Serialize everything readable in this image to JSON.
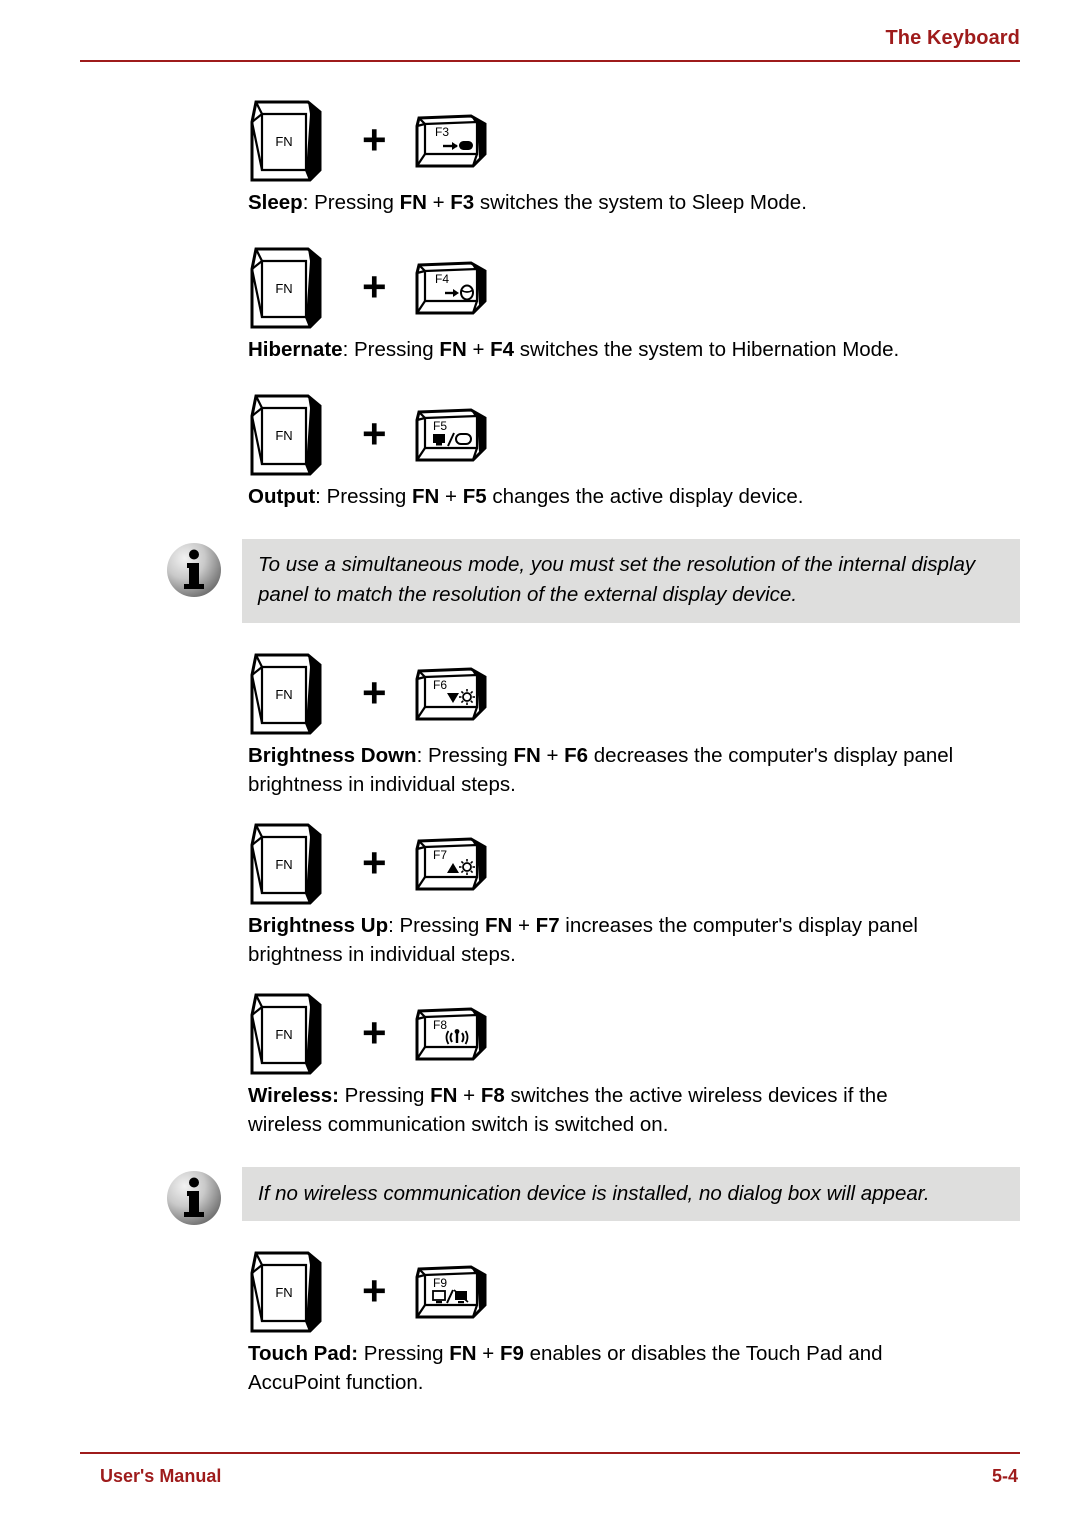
{
  "header": {
    "title": "The Keyboard"
  },
  "footer": {
    "left": "User's Manual",
    "page": "5-4"
  },
  "sections": [
    {
      "key_combo": {
        "modifier": "FN",
        "function_key": "F3",
        "separator": "+",
        "icon": "sleep-arrow-icon"
      },
      "paragraph": {
        "term": "Sleep",
        "after_term": ": Pressing ",
        "bold1": "FN",
        "mid": " + ",
        "bold2": "F3",
        "tail": " switches the system to Sleep Mode."
      }
    },
    {
      "key_combo": {
        "modifier": "FN",
        "function_key": "F4",
        "separator": "+",
        "icon": "hibernate-disk-icon"
      },
      "paragraph": {
        "term": "Hibernate",
        "after_term": ": Pressing ",
        "bold1": "FN",
        "mid": " + ",
        "bold2": "F4",
        "tail": " switches the system to Hibernation Mode."
      }
    },
    {
      "key_combo": {
        "modifier": "FN",
        "function_key": "F5",
        "separator": "+",
        "icon": "display-output-icon"
      },
      "paragraph": {
        "term": "Output",
        "after_term": ": Pressing ",
        "bold1": "FN",
        "mid": " + ",
        "bold2": "F5",
        "tail": " changes the active display device."
      }
    },
    {
      "key_combo": {
        "modifier": "FN",
        "function_key": "F6",
        "separator": "+",
        "icon": "brightness-down-icon"
      },
      "paragraph": {
        "term": "Brightness Down",
        "after_term": ": Pressing ",
        "bold1": "FN",
        "mid": " + ",
        "bold2": "F6",
        "tail": " decreases the computer's display panel brightness in individual steps."
      }
    },
    {
      "key_combo": {
        "modifier": "FN",
        "function_key": "F7",
        "separator": "+",
        "icon": "brightness-up-icon"
      },
      "paragraph": {
        "term": "Brightness Up",
        "after_term": ": Pressing ",
        "bold1": "FN",
        "mid": " + ",
        "bold2": "F7",
        "tail": " increases the computer's display panel brightness in individual steps."
      }
    },
    {
      "key_combo": {
        "modifier": "FN",
        "function_key": "F8",
        "separator": "+",
        "icon": "wireless-antenna-icon"
      },
      "paragraph": {
        "term": "Wireless:",
        "after_term": " Pressing ",
        "bold1": "FN",
        "mid": " + ",
        "bold2": "F8",
        "tail": " switches the active wireless devices if the wireless communication switch is switched on."
      }
    },
    {
      "key_combo": {
        "modifier": "FN",
        "function_key": "F9",
        "separator": "+",
        "icon": "touchpad-toggle-icon"
      },
      "paragraph": {
        "term": "Touch Pad:",
        "after_term": " Pressing ",
        "bold1": "FN",
        "mid": " + ",
        "bold2": "F9",
        "tail": " enables or disables the Touch Pad and AccuPoint function."
      }
    }
  ],
  "notes": [
    {
      "icon": "info-icon",
      "text": "To use a simultaneous mode, you must set the resolution of the internal display panel to match the resolution of the external display device."
    },
    {
      "icon": "info-icon",
      "text": "If no wireless communication device is installed, no dialog box will appear."
    }
  ],
  "colors": {
    "accent_red": "#9E1B1B",
    "note_background": "#DEDEDD",
    "text": "#000000"
  }
}
